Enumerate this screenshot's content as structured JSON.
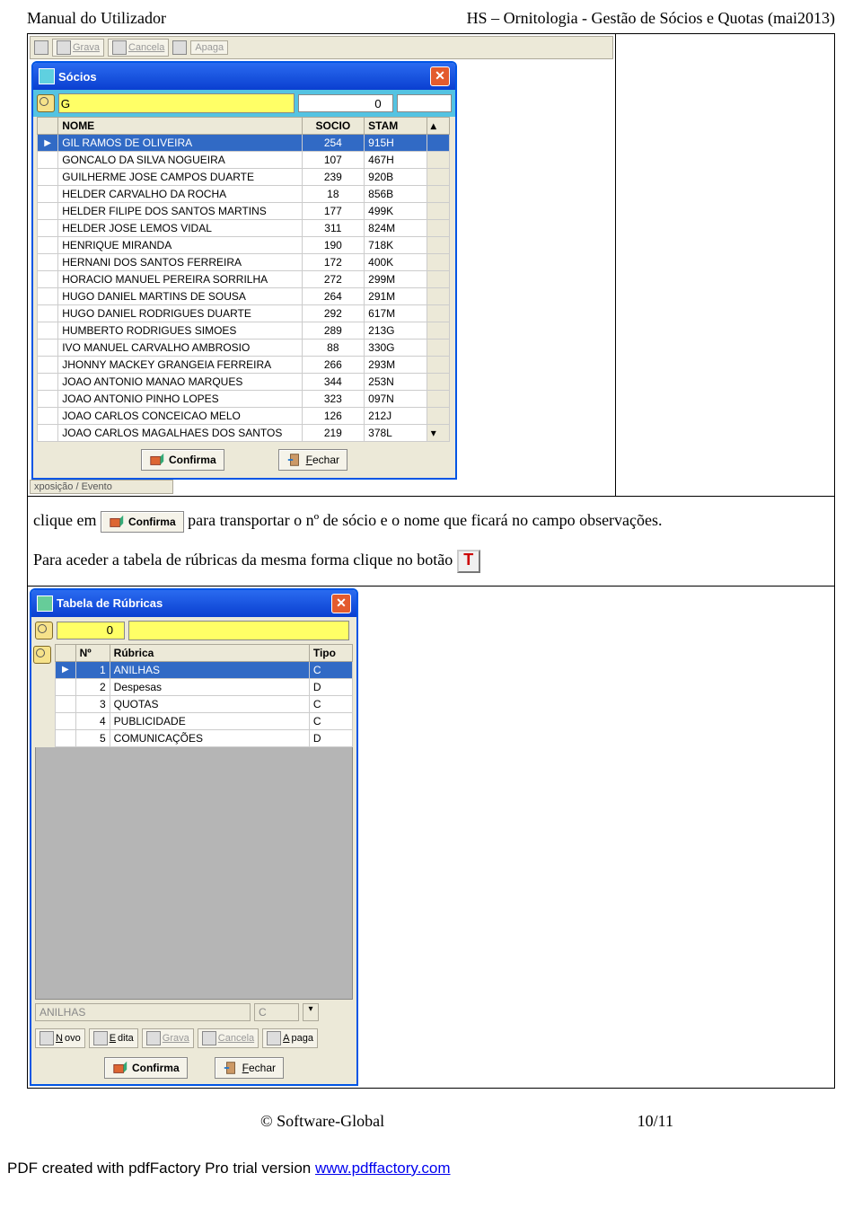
{
  "header": {
    "left": "Manual do Utilizador",
    "right": "HS – Ornitologia - Gestão de Sócios e Quotas (mai2013)"
  },
  "top_toolbar": {
    "grava": "Grava",
    "cancela": "Cancela",
    "apaga": "Apaga"
  },
  "socios_window": {
    "title": "Sócios",
    "search_value": "G",
    "num_value": "0",
    "cols": {
      "nome": "NOME",
      "socio": "SOCIO",
      "stam": "STAM"
    },
    "rows": [
      {
        "nome": "GIL RAMOS DE OLIVEIRA",
        "socio": "254",
        "stam": "915H",
        "sel": true
      },
      {
        "nome": "GONCALO DA SILVA NOGUEIRA",
        "socio": "107",
        "stam": "467H"
      },
      {
        "nome": "GUILHERME JOSE CAMPOS DUARTE",
        "socio": "239",
        "stam": "920B"
      },
      {
        "nome": "HELDER CARVALHO DA ROCHA",
        "socio": "18",
        "stam": "856B"
      },
      {
        "nome": "HELDER FILIPE DOS SANTOS MARTINS",
        "socio": "177",
        "stam": "499K"
      },
      {
        "nome": "HELDER JOSE LEMOS VIDAL",
        "socio": "311",
        "stam": "824M"
      },
      {
        "nome": "HENRIQUE MIRANDA",
        "socio": "190",
        "stam": "718K"
      },
      {
        "nome": "HERNANI DOS SANTOS FERREIRA",
        "socio": "172",
        "stam": "400K"
      },
      {
        "nome": "HORACIO MANUEL PEREIRA SORRILHA",
        "socio": "272",
        "stam": "299M"
      },
      {
        "nome": "HUGO DANIEL MARTINS DE SOUSA",
        "socio": "264",
        "stam": "291M"
      },
      {
        "nome": "HUGO DANIEL RODRIGUES DUARTE",
        "socio": "292",
        "stam": "617M"
      },
      {
        "nome": "HUMBERTO RODRIGUES SIMOES",
        "socio": "289",
        "stam": "213G"
      },
      {
        "nome": "IVO MANUEL CARVALHO AMBROSIO",
        "socio": "88",
        "stam": "330G"
      },
      {
        "nome": "JHONNY MACKEY GRANGEIA FERREIRA",
        "socio": "266",
        "stam": "293M"
      },
      {
        "nome": "JOAO ANTONIO MANAO MARQUES",
        "socio": "344",
        "stam": "253N"
      },
      {
        "nome": "JOAO ANTONIO PINHO LOPES",
        "socio": "323",
        "stam": "097N"
      },
      {
        "nome": "JOAO CARLOS CONCEICAO MELO",
        "socio": "126",
        "stam": "212J"
      },
      {
        "nome": "JOAO CARLOS MAGALHAES DOS SANTOS",
        "socio": "219",
        "stam": "378L"
      }
    ],
    "confirma": "Confirma",
    "fechar": "Fechar"
  },
  "status_strip": "xposição / Evento",
  "body": {
    "p1a": "clique em ",
    "confirma_inline": "Confirma",
    "p1b": " para transportar o nº de sócio e o nome que ficará no campo observações.",
    "p2": "Para aceder a tabela de rúbricas da mesma forma clique no botão ",
    "t_icon": "T"
  },
  "rubricas_window": {
    "title": "Tabela de Rúbricas",
    "num_value": "0",
    "cols": {
      "n": "Nº",
      "rubrica": "Rúbrica",
      "tipo": "Tipo"
    },
    "rows": [
      {
        "n": "1",
        "rubrica": "ANILHAS",
        "tipo": "C",
        "sel": true
      },
      {
        "n": "2",
        "rubrica": "Despesas",
        "tipo": "D"
      },
      {
        "n": "3",
        "rubrica": "QUOTAS",
        "tipo": "C"
      },
      {
        "n": "4",
        "rubrica": "PUBLICIDADE",
        "tipo": "C"
      },
      {
        "n": "5",
        "rubrica": "COMUNICAÇÕES",
        "tipo": "D"
      }
    ],
    "sel_name": "ANILHAS",
    "sel_tipo": "C",
    "toolbar": {
      "novo": "Novo",
      "edita": "Edita",
      "grava": "Grava",
      "cancela": "Cancela",
      "apaga": "Apaga"
    },
    "confirma": "Confirma",
    "fechar": "Fechar"
  },
  "footer": {
    "copyright": "© Software-Global",
    "page": "10/11"
  },
  "pdf": {
    "prefix": "PDF created with pdfFactory Pro trial version ",
    "link": "www.pdffactory.com"
  }
}
